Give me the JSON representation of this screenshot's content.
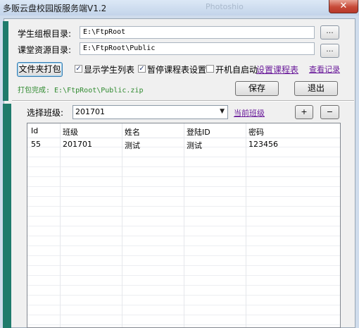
{
  "window": {
    "title": "多贩云盘校园版服务端V1.2",
    "background_ghost": "Photoshio",
    "close_glyph": "✕"
  },
  "paths": {
    "student_root_label": "学生组根目录:",
    "student_root_value": "E:\\FtpRoot",
    "course_res_label": "课堂资源目录:",
    "course_res_value": "E:\\FtpRoot\\Public",
    "browse_label": "..."
  },
  "options": {
    "pack_button": "文件夹打包",
    "show_students_label": "显示学生列表",
    "show_students_checked": true,
    "pause_schedule_label": "暂停课程表设置",
    "pause_schedule_checked": true,
    "autostart_label": "开机自启动",
    "autostart_checked": false,
    "set_schedule_link": "设置课程表",
    "view_log_link": "查看记录"
  },
  "status": {
    "text": "打包完成: E:\\FtpRoot\\Public.zip"
  },
  "actions": {
    "save": "保存",
    "exit": "退出"
  },
  "class_panel": {
    "select_label": "选择班级:",
    "selected_class": "201701",
    "current_class_link": "当前班级",
    "add_label": "+",
    "remove_label": "−"
  },
  "table": {
    "columns": [
      "Id",
      "班级",
      "姓名",
      "登陆ID",
      "密码"
    ],
    "rows": [
      [
        "55",
        "201701",
        "测试",
        "测试",
        "123456"
      ]
    ]
  },
  "colors": {
    "accent": "#1f7b6c",
    "link": "#6a1b9a",
    "status_text": "#2f8a2f",
    "close": "#c74a38"
  }
}
